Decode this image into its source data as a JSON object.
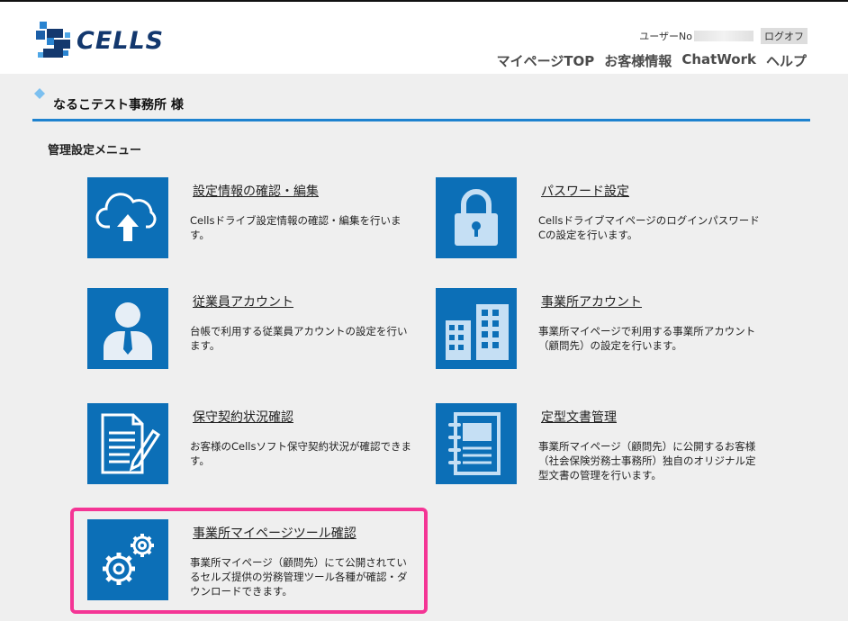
{
  "header": {
    "logo_text": "CELLS",
    "user_no_label": "ユーザーNo",
    "logoff_label": "ログオフ",
    "nav": [
      "マイページTOP",
      "お客様情報",
      "ChatWork",
      "ヘルプ"
    ]
  },
  "office": {
    "name": "なるこテスト事務所 様"
  },
  "menu": {
    "title": "管理設定メニュー",
    "items": [
      {
        "title": "設定情報の確認・編集",
        "desc": "Cellsドライブ設定情報の確認・編集を行います。",
        "icon": "cloud-upload-icon"
      },
      {
        "title": "パスワード設定",
        "desc": "CellsドライブマイページのログインパスワードCの設定を行います。",
        "icon": "lock-icon"
      },
      {
        "title": "従業員アカウント",
        "desc": "台帳で利用する従業員アカウントの設定を行います。",
        "icon": "person-icon"
      },
      {
        "title": "事業所アカウント",
        "desc": "事業所マイページで利用する事業所アカウント（顧問先）の設定を行います。",
        "icon": "buildings-icon"
      },
      {
        "title": "保守契約状況確認",
        "desc": "お客様のCellsソフト保守契約状況が確認できます。",
        "icon": "document-pen-icon"
      },
      {
        "title": "定型文書管理",
        "desc": "事業所マイページ（顧問先）に公開するお客様（社会保険労務士事務所）独自のオリジナル定型文書の管理を行います。",
        "icon": "notebook-icon"
      },
      {
        "title": "事業所マイページツール確認",
        "desc": "事業所マイページ（顧問先）にて公開されているセルズ提供の労務管理ツール各種が確認・ダウンロードできます。",
        "icon": "gears-icon"
      }
    ]
  },
  "colors": {
    "accent": "#1e82cf",
    "tile": "#0c6fb7",
    "highlight": "#f43595"
  }
}
